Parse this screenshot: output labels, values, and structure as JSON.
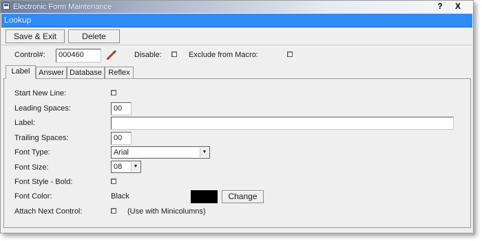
{
  "window": {
    "title": "Electronic Form Maintenance",
    "help_label": "?",
    "close_label": "X",
    "header": "Lookup"
  },
  "toolbar": {
    "save_exit_label": "Save & Exit",
    "delete_label": "Delete"
  },
  "control": {
    "label": "Control#:",
    "value": "000460",
    "disable_label": "Disable:",
    "disable_checked": false,
    "exclude_label": "Exclude from Macro:",
    "exclude_checked": false
  },
  "tabs": [
    {
      "label": "Label",
      "active": true
    },
    {
      "label": "Answer",
      "active": false
    },
    {
      "label": "Database",
      "active": false
    },
    {
      "label": "Reflex",
      "active": false
    }
  ],
  "form": {
    "start_new_line_label": "Start New Line:",
    "start_new_line_checked": false,
    "leading_spaces_label": "Leading Spaces:",
    "leading_spaces_value": "00",
    "label_label": "Label:",
    "label_value": "",
    "trailing_spaces_label": "Trailing Spaces:",
    "trailing_spaces_value": "00",
    "font_type_label": "Font Type:",
    "font_type_value": "Arial",
    "font_size_label": "Font Size:",
    "font_size_value": "08",
    "font_style_bold_label": "Font Style - Bold:",
    "font_style_bold_checked": false,
    "font_color_label": "Font Color:",
    "font_color_value": "Black",
    "font_color_swatch": "#000000",
    "change_label": "Change",
    "attach_next_label": "Attach Next Control:",
    "attach_next_checked": false,
    "attach_next_note": "(Use with Minicolumns)"
  },
  "colors": {
    "header_bar": "#2f8cf4",
    "window_bg": "#efefef"
  }
}
